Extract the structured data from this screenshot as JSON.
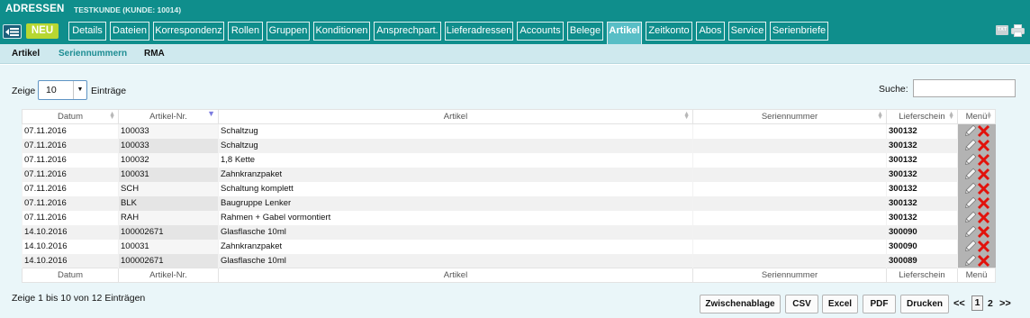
{
  "header": {
    "app_title": "ADRESSEN",
    "customer": "TESTKUNDE (KUNDE: 10014)",
    "new_label": "NEU",
    "tabs": [
      {
        "label": "Details",
        "active": false
      },
      {
        "label": "Dateien",
        "active": false
      },
      {
        "label": "Korrespondenz",
        "active": false
      },
      {
        "label": "Rollen",
        "active": false
      },
      {
        "label": "Gruppen",
        "active": false
      },
      {
        "label": "Konditionen",
        "active": false
      },
      {
        "label": "Ansprechpart.",
        "active": false
      },
      {
        "label": "Lieferadressen",
        "active": false
      },
      {
        "label": "Accounts",
        "active": false
      },
      {
        "label": "Belege",
        "active": false
      },
      {
        "label": "Artikel",
        "active": true
      },
      {
        "label": "Zeitkonto",
        "active": false
      },
      {
        "label": "Abos",
        "active": false
      },
      {
        "label": "Service",
        "active": false
      },
      {
        "label": "Serienbriefe",
        "active": false
      }
    ],
    "txt_icon_label": "TXT"
  },
  "subtabs": [
    {
      "label": "Artikel",
      "active": false
    },
    {
      "label": "Seriennummern",
      "active": true
    },
    {
      "label": "RMA",
      "active": false
    }
  ],
  "controls": {
    "show_label": "Zeige",
    "page_size": "10",
    "entries_label": "Einträge",
    "search_label": "Suche:",
    "search_value": ""
  },
  "table": {
    "columns": [
      "Datum",
      "Artikel-Nr.",
      "Artikel",
      "Seriennummer",
      "Lieferschein",
      "Menü"
    ],
    "rows": [
      {
        "datum": "07.11.2016",
        "nr": "100033",
        "artikel": "Schaltzug",
        "serial": "",
        "ls": "300132"
      },
      {
        "datum": "07.11.2016",
        "nr": "100033",
        "artikel": "Schaltzug",
        "serial": "",
        "ls": "300132"
      },
      {
        "datum": "07.11.2016",
        "nr": "100032",
        "artikel": "1,8 Kette",
        "serial": "",
        "ls": "300132"
      },
      {
        "datum": "07.11.2016",
        "nr": "100031",
        "artikel": "Zahnkranzpaket",
        "serial": "",
        "ls": "300132"
      },
      {
        "datum": "07.11.2016",
        "nr": "SCH",
        "artikel": "Schaltung komplett",
        "serial": "",
        "ls": "300132"
      },
      {
        "datum": "07.11.2016",
        "nr": "BLK",
        "artikel": "Baugruppe Lenker",
        "serial": "",
        "ls": "300132"
      },
      {
        "datum": "07.11.2016",
        "nr": "RAH",
        "artikel": "Rahmen + Gabel vormontiert",
        "serial": "",
        "ls": "300132"
      },
      {
        "datum": "14.10.2016",
        "nr": "100002671",
        "artikel": "Glasflasche 10ml",
        "serial": "",
        "ls": "300090"
      },
      {
        "datum": "14.10.2016",
        "nr": "100031",
        "artikel": "Zahnkranzpaket",
        "serial": "",
        "ls": "300090"
      },
      {
        "datum": "14.10.2016",
        "nr": "100002671",
        "artikel": "Glasflasche 10ml",
        "serial": "",
        "ls": "300089"
      }
    ]
  },
  "footer": {
    "info": "Zeige 1 bis 10 von 12 Einträgen",
    "buttons": [
      "Zwischenablage",
      "CSV",
      "Excel",
      "PDF",
      "Drucken"
    ],
    "pagination": {
      "prev": "<<",
      "current": "1",
      "next_page": "2",
      "next": ">>"
    }
  },
  "colors": {
    "header_bg": "#0f8e8c",
    "active_tab": "#58bec6",
    "new_button": "#b7d732",
    "subbar_bg": "#cfe9ee",
    "content_bg": "#eaf6f9"
  }
}
